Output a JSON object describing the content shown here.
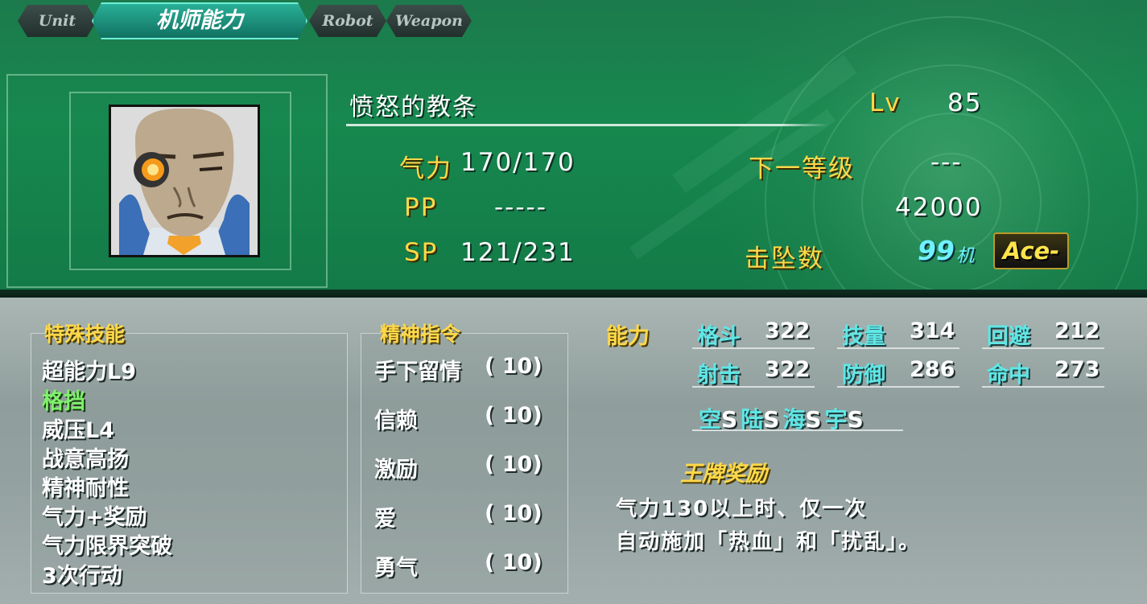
{
  "tabs": [
    {
      "label": "Unit",
      "active": false
    },
    {
      "label": "机师能力",
      "active": true
    },
    {
      "label": "Robot",
      "active": false
    },
    {
      "label": "Weapon",
      "active": false
    }
  ],
  "pilot": {
    "name": "愤怒的教条",
    "lv_label": "Lv",
    "lv_value": "85",
    "will_label": "气力",
    "will_value": "170/170",
    "pp_label": "PP",
    "pp_value": "-----",
    "sp_label": "SP",
    "sp_value": "121/231",
    "next_level_label": "下一等级",
    "next_level_value": "---",
    "exp_value": "42000",
    "kills_label": "击坠数",
    "kills_value": "99",
    "kills_unit": "机",
    "ace_badge": "Ace-"
  },
  "skills": {
    "title": "特殊技能",
    "items": [
      {
        "label": "超能力L9",
        "highlight": false
      },
      {
        "label": "格挡",
        "highlight": true
      },
      {
        "label": "威压L4",
        "highlight": false
      },
      {
        "label": "战意高扬",
        "highlight": false
      },
      {
        "label": "精神耐性",
        "highlight": false
      },
      {
        "label": "气力+奖励",
        "highlight": false
      },
      {
        "label": "气力限界突破",
        "highlight": false
      },
      {
        "label": "3次行动",
        "highlight": false
      }
    ]
  },
  "spirits": {
    "title": "精神指令",
    "items": [
      {
        "name": "手下留情",
        "cost": "( 10)"
      },
      {
        "name": "信赖",
        "cost": "( 10)"
      },
      {
        "name": "激励",
        "cost": "( 10)"
      },
      {
        "name": "爱",
        "cost": "( 10)"
      },
      {
        "name": "勇气",
        "cost": "( 10)"
      }
    ]
  },
  "abilities": {
    "title": "能力",
    "stats": [
      {
        "label": "格斗",
        "value": "322"
      },
      {
        "label": "技量",
        "value": "314"
      },
      {
        "label": "回避",
        "value": "212"
      },
      {
        "label": "射击",
        "value": "322"
      },
      {
        "label": "防御",
        "value": "286"
      },
      {
        "label": "命中",
        "value": "273"
      }
    ],
    "terrain": [
      {
        "label": "空",
        "value": "S"
      },
      {
        "label": "陆",
        "value": "S"
      },
      {
        "label": "海",
        "value": "S"
      },
      {
        "label": "宇",
        "value": "S"
      }
    ]
  },
  "ace_bonus": {
    "title": "王牌奖励",
    "line1": "气力130以上时、仅一次",
    "line2": "自动施加「热血」和「扰乱」。"
  },
  "colors": {
    "accent_gold": "#ffd84a",
    "accent_cyan": "#60e6e6",
    "skill_green": "#7ff06a",
    "panel_green": "#17884f"
  }
}
